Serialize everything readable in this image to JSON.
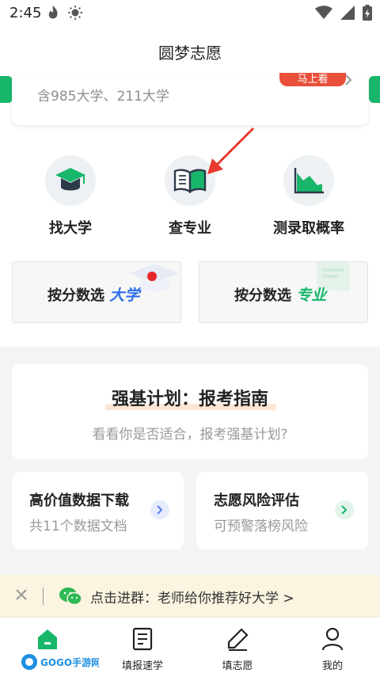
{
  "status_bar": {
    "time": "2:45"
  },
  "header": {
    "title": "圆梦志愿"
  },
  "top_card": {
    "subtitle": "含985大学、211大学",
    "button_label": "马上看"
  },
  "functions": [
    {
      "label": "找大学",
      "icon": "graduation-cap-icon"
    },
    {
      "label": "查专业",
      "icon": "open-book-icon"
    },
    {
      "label": "测录取概率",
      "icon": "area-chart-icon"
    }
  ],
  "score_cards": [
    {
      "label": "按分数选",
      "accent": "大学",
      "accent_color": "#2b6fe8"
    },
    {
      "label": "按分数选",
      "accent": "专业",
      "accent_color": "#18b66a"
    }
  ],
  "qiangji": {
    "title": "强基计划：报考指南",
    "subtitle": "看看你是否适合，报考强基计划?"
  },
  "mini_cards": [
    {
      "title": "高价值数据下载",
      "subtitle": "共11个数据文档",
      "arrow_color": "#5b7ef0",
      "arrow_bg": "#e6ecfd"
    },
    {
      "title": "志愿风险评估",
      "subtitle": "可预警落榜风险",
      "arrow_color": "#18b66a",
      "arrow_bg": "#e1f5ea"
    }
  ],
  "banner": {
    "text": "点击进群：老师给你推荐好大学 >"
  },
  "tabs": [
    {
      "label": "",
      "icon": "home-icon"
    },
    {
      "label": "填报速学",
      "icon": "document-icon"
    },
    {
      "label": "填志愿",
      "icon": "pen-icon"
    },
    {
      "label": "我的",
      "icon": "user-icon"
    }
  ],
  "watermark": {
    "text": "GOGO手游网"
  },
  "colors": {
    "brand_green": "#18b66a",
    "accent_red": "#e8503a",
    "text_primary": "#222222",
    "text_secondary": "#999999"
  }
}
